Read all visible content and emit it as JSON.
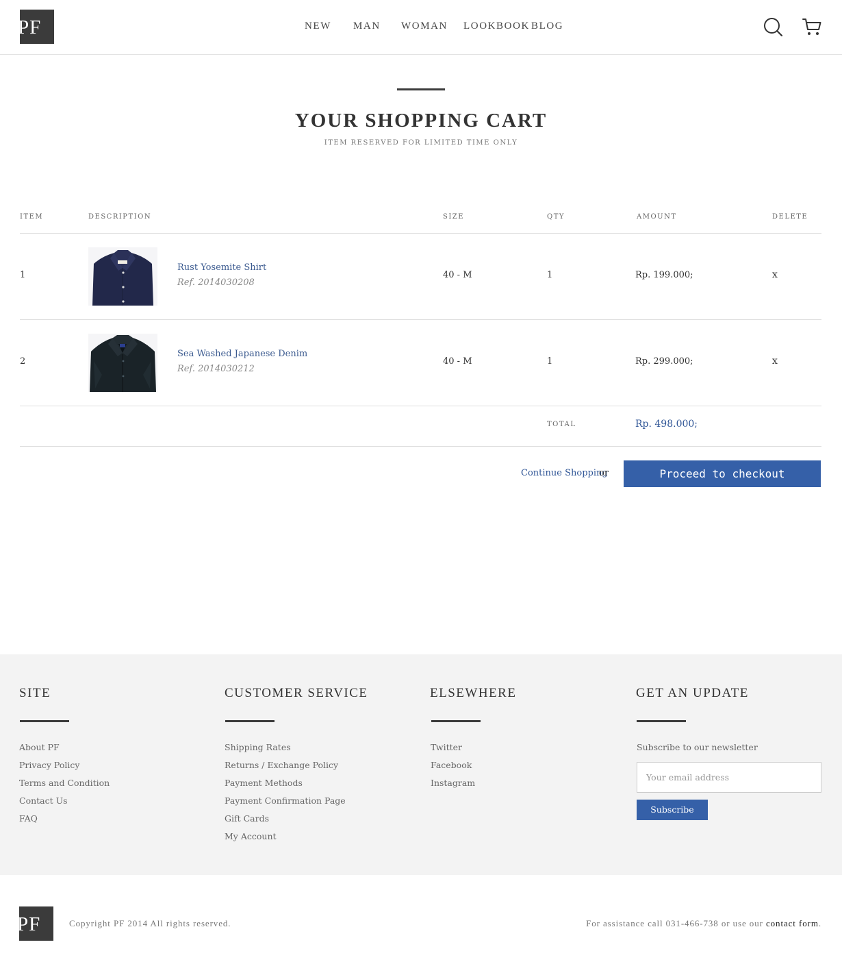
{
  "brand": {
    "logo_text": "PF"
  },
  "nav": {
    "items": [
      "NEW",
      "MAN",
      "WOMAN",
      "LOOKBOOK",
      "BLOG"
    ]
  },
  "header_icons": [
    "search-icon",
    "cart-icon"
  ],
  "page": {
    "title": "YOUR SHOPPING CART",
    "subtitle": "ITEM RESERVED FOR LIMITED TIME ONLY"
  },
  "cart": {
    "columns": [
      "ITEM",
      "DESCRIPTION",
      "SIZE",
      "QTY",
      "AMOUNT",
      "DELETE"
    ],
    "items": [
      {
        "index": "1",
        "name": "Rust Yosemite Shirt",
        "ref": "Ref. 2014030208",
        "size": "40 - M",
        "qty": "1",
        "amount": "Rp. 199.000;",
        "delete": "x"
      },
      {
        "index": "2",
        "name": "Sea Washed Japanese Denim",
        "ref": "Ref. 2014030212",
        "size": "40 - M",
        "qty": "1",
        "amount": "Rp. 299.000;",
        "delete": "x"
      }
    ],
    "total_label": "TOTAL",
    "total_value": "Rp. 498.000;",
    "continue_label": "Continue Shopping",
    "or_label": "or",
    "checkout_label": "Proceed to checkout"
  },
  "footer": {
    "site": {
      "title": "SITE",
      "links": [
        "About PF",
        "Privacy Policy",
        "Terms and Condition",
        "Contact Us",
        "FAQ"
      ]
    },
    "customer_service": {
      "title": "CUSTOMER SERVICE",
      "links": [
        "Shipping Rates",
        "Returns / Exchange Policy",
        "Payment Methods",
        "Payment Confirmation Page",
        "Gift Cards",
        "My Account"
      ]
    },
    "elsewhere": {
      "title": "ELSEWHERE",
      "links": [
        "Twitter",
        "Facebook",
        "Instagram"
      ]
    },
    "update": {
      "title": "GET AN UPDATE",
      "text": "Subscribe to our newsletter",
      "email_placeholder": "Your email address",
      "subscribe_label": "Subscribe"
    }
  },
  "bottom": {
    "copyright": "Copyright PF 2014 All rights reserved.",
    "assist_text": "For assistance call 031-466-738 or use our ",
    "assist_link": "contact form",
    "assist_end": "."
  },
  "colors": {
    "accent": "#3560a8",
    "link": "#2f5596",
    "logo_bg": "#3b3b3b",
    "footer_bg": "#f3f3f3"
  }
}
